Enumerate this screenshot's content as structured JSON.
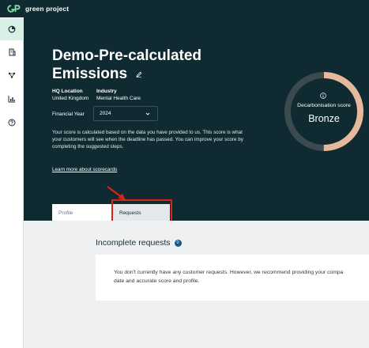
{
  "app": {
    "name": "green project"
  },
  "sidebar": {
    "items": [
      {
        "icon": "dashboard-icon",
        "active": true
      },
      {
        "icon": "building-icon",
        "active": false
      },
      {
        "icon": "network-icon",
        "active": false
      },
      {
        "icon": "bar-chart-icon",
        "active": false
      },
      {
        "icon": "help-icon",
        "active": false
      }
    ]
  },
  "company": {
    "name": "Demo-Pre-calculated Emissions",
    "hq_label": "HQ Location",
    "hq_value": "United Kingdom",
    "industry_label": "Industry",
    "industry_value": "Mental Health Care",
    "fy_label": "Financial Year",
    "fy_value": "2024",
    "description": "Your score is calculated based on the data you have provided to us. This score is what your customers will see when the deadline has passed. You can improve your score by completing the suggested steps.",
    "learn_link": "Learn more about scorecards"
  },
  "score": {
    "label": "Decarbonisation score",
    "value": "Bronze",
    "fill_fraction": 0.5,
    "fill_color": "#e6b99d",
    "track_color": "#3b4a4f"
  },
  "tabs": [
    {
      "label": "Profile",
      "active": false
    },
    {
      "label": "Requests",
      "active": true
    }
  ],
  "requests": {
    "title": "Incomplete requests",
    "count": "0",
    "empty_line1": "You don't currently have any customer requests. However, we recommend providing your compa",
    "empty_line2": "date and accurate score and profile."
  },
  "colors": {
    "header_bg": "#0f2a31",
    "annotation_red": "#d9231d",
    "active_nav_bg": "#d8f0e6"
  }
}
